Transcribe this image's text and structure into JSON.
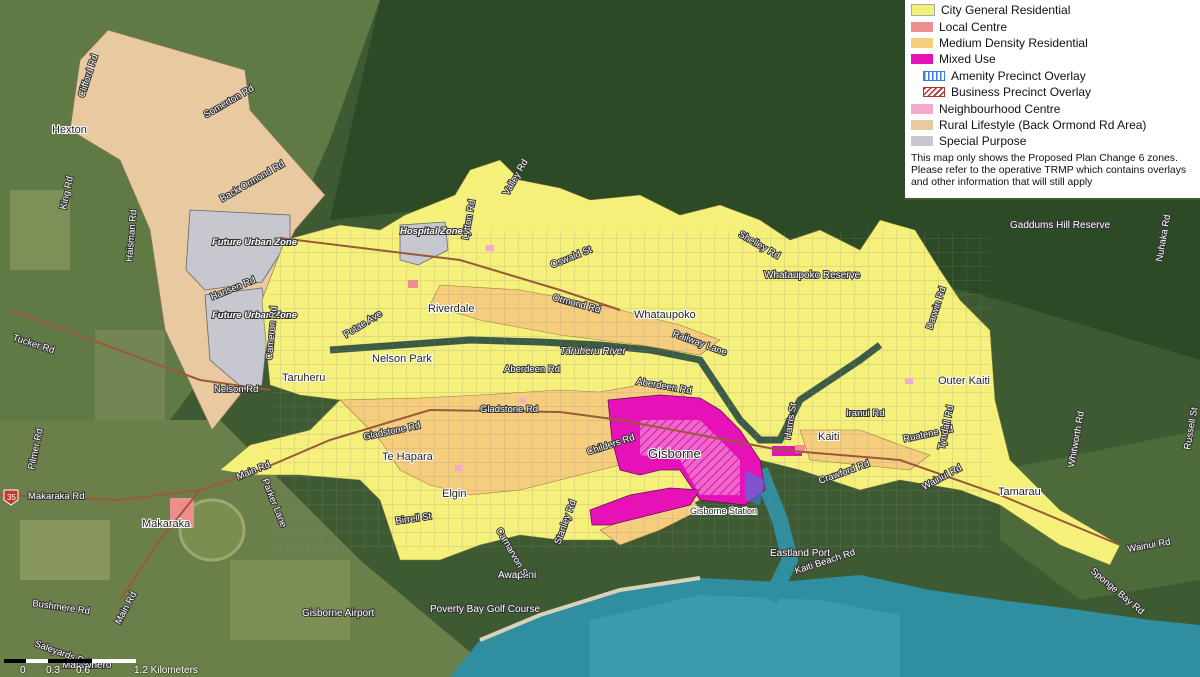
{
  "legend": {
    "items": [
      {
        "label": "City General Residential",
        "color": "#f5f07a"
      },
      {
        "label": "Local Centre",
        "color": "#ee8d8d"
      },
      {
        "label": "Medium Density Residential",
        "color": "#f6cd7d"
      },
      {
        "label": "Mixed Use",
        "color": "#e612b8"
      }
    ],
    "overlays": [
      {
        "label": "Amenity Precinct Overlay",
        "color": "#3a7ee0"
      },
      {
        "label": "Business Precinct Overlay",
        "color": "#b3302c"
      }
    ],
    "items2": [
      {
        "label": "Neighbourhood Centre",
        "color": "#f4a9cf"
      },
      {
        "label": "Rural Lifestyle (Back Ormond Rd Area)",
        "color": "#e9c9a0"
      },
      {
        "label": "Special Purpose",
        "color": "#c7c7cf"
      }
    ],
    "note": "This map only shows the Proposed Plan Change 6 zones. Please refer to the operative TRMP which contains overlays and other information that will still apply"
  },
  "map": {
    "places": {
      "hexton": "Hexton",
      "riverdale": "Riverdale",
      "nelson_park": "Nelson Park",
      "taruheru": "Taruheru",
      "te_hapara": "Te Hapara",
      "elgin": "Elgin",
      "gisborne": "Gisborne",
      "gisborne_station": "Gisborne Station",
      "whataupoko": "Whataupoko",
      "whataupoko_reserve": "Whataupoko Reserve",
      "outer_kaiti": "Outer Kaiti",
      "kaiti": "Kaiti",
      "tamarau": "Tamarau",
      "eastland_port": "Eastland Port",
      "awapuni": "Awapuni",
      "makaraka": "Makaraka",
      "gaddums": "Gaddums Hill Reserve",
      "airport": "Gisborne Airport",
      "golf": "Poverty Bay Golf Course",
      "matawhero": "Matawhero",
      "river": "Taruheru River"
    },
    "zones": {
      "hospital": "Hospital Zone",
      "fuz1": "Future Urban Zone",
      "fuz2": "Future Urban Zone"
    },
    "roads": {
      "back_ormond": "Back Ormond Rd",
      "ormond": "Ormond Rd",
      "gladstone1": "Gladstone Rd",
      "gladstone2": "Gladstone Rd",
      "aberdeen1": "Aberdeen Rd",
      "aberdeen2": "Aberdeen Rd",
      "makaraka": "Makaraka Rd",
      "main1": "Main Rd",
      "main2": "Main Rd",
      "nelson": "Nelson Rd",
      "wainui1": "Wainui Rd",
      "wainui2": "Wainui Rd",
      "tucker": "Tucker Rd",
      "bushmere": "Bushmere Rd",
      "saleyards": "Saleyards Rd",
      "king": "King Rd",
      "haisman": "Haisman Rd",
      "hansen": "Hansen Rd",
      "cameron": "Cameron Rd",
      "somerton": "Somerton Rd",
      "clifford": "Clifford Rd",
      "valley": "Valley Rd",
      "oswald": "Oswald St",
      "shelley": "Shelley Rd",
      "lytton": "Lytton Rd",
      "potae": "Potae Ave",
      "childers": "Childers Rd",
      "birrell": "Birrell St",
      "stanley": "Stanley Rd",
      "iranui": "Iranui Rd",
      "ruatene": "Ruatene Rd",
      "crawford": "Crawford Rd",
      "kaiti_beach": "Kaiti Beach Rd",
      "sponge_bay": "Sponge Bay Rd",
      "railway": "Railway Lane",
      "darwin": "Darwin Rd",
      "tyndall": "Tyndall Rd",
      "harris": "Harris St",
      "carnarvon": "Carnarvon St",
      "parker": "Parker Lane",
      "whitworth": "Whitworth Rd",
      "pilmer": "Pilmer Rd",
      "nuhaka": "Nuhaka Rd",
      "russell": "Russell St",
      "rd_35": "35"
    },
    "scale": {
      "t0": "0",
      "t1": "0.3",
      "t2": "0.6",
      "t3": "1.2 Kilometers"
    }
  }
}
